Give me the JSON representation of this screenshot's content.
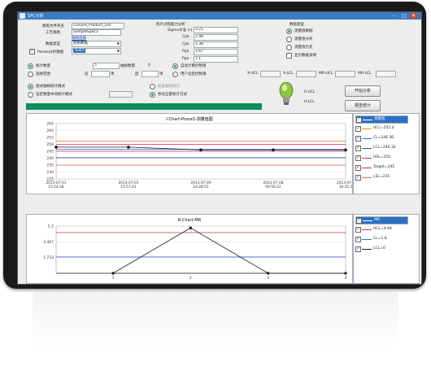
{
  "window": {
    "title": "SPC分析",
    "controls": [
      "–",
      "□",
      "✕"
    ]
  },
  "form": {
    "file_label": "图纸文件夹名",
    "file_value": "Closure_Product_List",
    "process_label": "工艺规格",
    "process_value": "SampleSpec2",
    "process_link": "规格选择",
    "data_type_label": "数据类型",
    "data_type_value": "原始数据",
    "sub_label": "Pareto分析数据",
    "sub_value": "Sub1"
  },
  "capability": {
    "title": "统计过程能力分析",
    "rows": [
      {
        "label": "Sigma水准 (s)",
        "value": "3.21"
      },
      {
        "label": "Cpk",
        "value": "2.48"
      },
      {
        "label": "Cpk",
        "value": "1.38"
      },
      {
        "label": "Ppk",
        "value": "1.67"
      },
      {
        "label": "Ppk",
        "value": "1.1"
      }
    ]
  },
  "data_source": {
    "title": "数据类型",
    "options": [
      "测量值数据",
      "测量值分析",
      "测量值历史"
    ],
    "checkbox": "显示数据详情"
  },
  "stats": {
    "stat_label": "统计数量",
    "stat_value": "5",
    "sample_label": "抽样数量",
    "sample_value": "0",
    "range_label": "选择范围",
    "range_from_label": "前",
    "range_unit": "项",
    "range_to_label": "后",
    "range_unit2": "项",
    "auto_limits": "自动计算控制限",
    "user_limits": "用户设定控制限",
    "ucl_labels": [
      "X-UCL",
      "X-LCL",
      "MR-UCL",
      "MR-LCL"
    ]
  },
  "mode": {
    "option1": "链式抽样统计模式",
    "option2": "设定数量中间统计模式",
    "option3": "标准抽样统计",
    "option4": "移动全部统计方式",
    "ucl_label": "0-UCL",
    "lcl_label": "0-LCL"
  },
  "buttons": {
    "start": "开始分析",
    "print": "报告统计"
  },
  "chart_data": [
    {
      "type": "line",
      "title": "I-Chart-Proce3-测量值图",
      "ylim": [
        225,
        265
      ],
      "yticks": [
        265,
        260,
        255,
        250,
        245,
        240,
        235,
        230,
        225
      ],
      "x_labels": [
        {
          "line1": "2013-07-01",
          "line2": "15:54:38"
        },
        {
          "line1": "2013-07-01",
          "line2": "15:57:41"
        },
        {
          "line1": "2013-07-09",
          "line2": "16:28:55"
        },
        {
          "line1": "2013-07-08",
          "line2": "09:56:22"
        },
        {
          "line1": "2013-07-0",
          "line2": "10:25:3"
        }
      ],
      "series": [
        {
          "name": "测量值",
          "color": "#222222",
          "values": [
            248,
            248,
            246,
            246,
            246
          ]
        }
      ],
      "limit_lines": [
        {
          "name": "UCL=252.4",
          "value": 252.4,
          "color": "#ee8833"
        },
        {
          "name": "CL=246.36",
          "value": 246.36,
          "color": "#4466cc"
        },
        {
          "name": "LCL=240.32",
          "value": 240.32,
          "color": "#3355aa"
        },
        {
          "name": "USL=250",
          "value": 250,
          "color": "#cc3355"
        },
        {
          "name": "Target=245",
          "value": 245,
          "color": "#bb3377"
        },
        {
          "name": "LSL=235",
          "value": 235,
          "color": "#dd6633"
        }
      ]
    },
    {
      "type": "line",
      "title": "R-Chart-MR",
      "ylim": [
        0,
        5.2
      ],
      "yticks": [
        5.2,
        3.467,
        1.733
      ],
      "categories": [
        "1",
        "2",
        "3",
        "4"
      ],
      "series": [
        {
          "name": "MR",
          "color": "#222222",
          "values": [
            0,
            5,
            0,
            0
          ]
        }
      ],
      "limit_lines": [
        {
          "name": "UCL=4.48",
          "value": 4.48,
          "color": "#cc3344"
        },
        {
          "name": "CL=1.8",
          "value": 1.8,
          "color": "#4466cc"
        },
        {
          "name": "LCL=0",
          "value": 0,
          "color": "#222222"
        }
      ]
    }
  ],
  "legend1": {
    "selected": "测量值",
    "items": [
      "UCL=252.4",
      "CL=246.36",
      "LCL=240.32",
      "USL=250",
      "Target=245",
      "LSL=235"
    ]
  },
  "legend2": {
    "selected": "MR",
    "items": [
      "UCL=4.48",
      "CL=1.8",
      "LCL=0"
    ]
  }
}
